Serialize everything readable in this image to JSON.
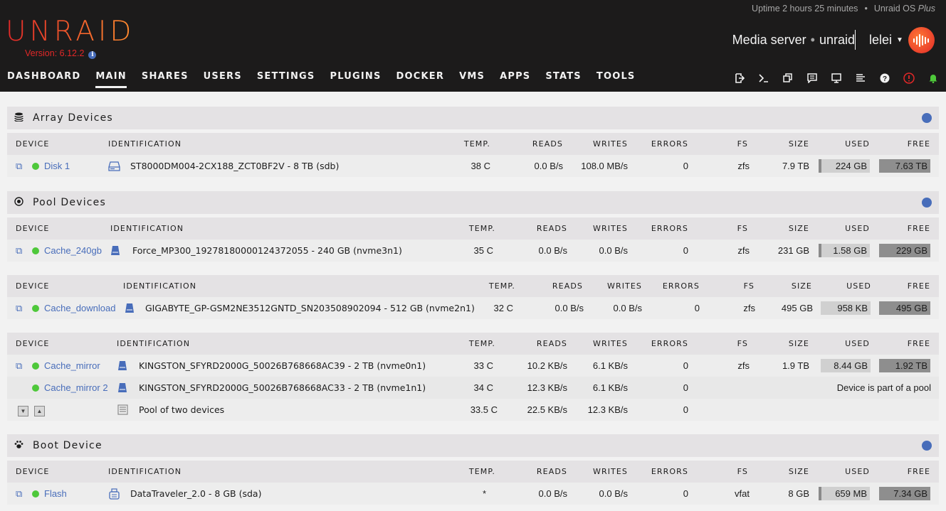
{
  "header": {
    "uptime": "Uptime 2 hours 25 minutes",
    "os_name": "Unraid OS",
    "os_edition": "Plus",
    "logo": "UNRAID",
    "version": "Version: 6.12.2",
    "server_description": "Media server",
    "server_name": "unraid",
    "user": "lelei"
  },
  "nav": [
    "DASHBOARD",
    "MAIN",
    "SHARES",
    "USERS",
    "SETTINGS",
    "PLUGINS",
    "DOCKER",
    "VMS",
    "APPS",
    "STATS",
    "TOOLS"
  ],
  "nav_active": "MAIN",
  "columns": [
    "DEVICE",
    "IDENTIFICATION",
    "TEMP.",
    "READS",
    "WRITES",
    "ERRORS",
    "FS",
    "SIZE",
    "USED",
    "FREE"
  ],
  "array": {
    "title": "Array Devices",
    "rows": [
      {
        "device": "Disk 1",
        "id": "ST8000DM004-2CX188_ZCT0BF2V - 8 TB (sdb)",
        "temp": "38 C",
        "reads": "0.0 B/s",
        "writes": "108.0 MB/s",
        "errors": "0",
        "fs": "zfs",
        "size": "7.9 TB",
        "used": "224 GB",
        "free": "7.63 TB",
        "used_frac": 0.03
      }
    ]
  },
  "pool": {
    "title": "Pool Devices",
    "cache_240": {
      "device": "Cache_240gb",
      "id": "Force_MP300_19278180000124372055 - 240 GB (nvme3n1)",
      "temp": "35 C",
      "reads": "0.0 B/s",
      "writes": "0.0 B/s",
      "errors": "0",
      "fs": "zfs",
      "size": "231 GB",
      "used": "1.58 GB",
      "free": "229 GB",
      "used_frac": 0.01
    },
    "cache_download": {
      "device": "Cache_download",
      "id": "GIGABYTE_GP-GSM2NE3512GNTD_SN203508902094 - 512 GB (nvme2n1)",
      "temp": "32 C",
      "reads": "0.0 B/s",
      "writes": "0.0 B/s",
      "errors": "0",
      "fs": "zfs",
      "size": "495 GB",
      "used": "958 KB",
      "free": "495 GB",
      "used_frac": 0.0
    },
    "cache_mirror": {
      "device": "Cache_mirror",
      "id": "KINGSTON_SFYRD2000G_50026B768668AC39 - 2 TB (nvme0n1)",
      "temp": "33 C",
      "reads": "10.2 KB/s",
      "writes": "6.1 KB/s",
      "errors": "0",
      "fs": "zfs",
      "size": "1.9 TB",
      "used": "8.44 GB",
      "free": "1.92 TB",
      "used_frac": 0.0
    },
    "cache_mirror_2": {
      "device": "Cache_mirror 2",
      "id": "KINGSTON_SFYRD2000G_50026B768668AC33 - 2 TB (nvme1n1)",
      "temp": "34 C",
      "reads": "12.3 KB/s",
      "writes": "6.1 KB/s",
      "errors": "0",
      "note": "Device is part of a pool"
    },
    "pool_total": {
      "id": "Pool of two devices",
      "temp": "33.5 C",
      "reads": "22.5 KB/s",
      "writes": "12.3 KB/s",
      "errors": "0"
    }
  },
  "boot": {
    "title": "Boot Device",
    "rows": [
      {
        "device": "Flash",
        "id": "DataTraveler_2.0 - 8 GB (sda)",
        "temp": "*",
        "reads": "0.0 B/s",
        "writes": "0.0 B/s",
        "errors": "0",
        "fs": "vfat",
        "size": "8 GB",
        "used": "659 MB",
        "free": "7.34 GB",
        "used_frac": 0.08
      }
    ]
  }
}
